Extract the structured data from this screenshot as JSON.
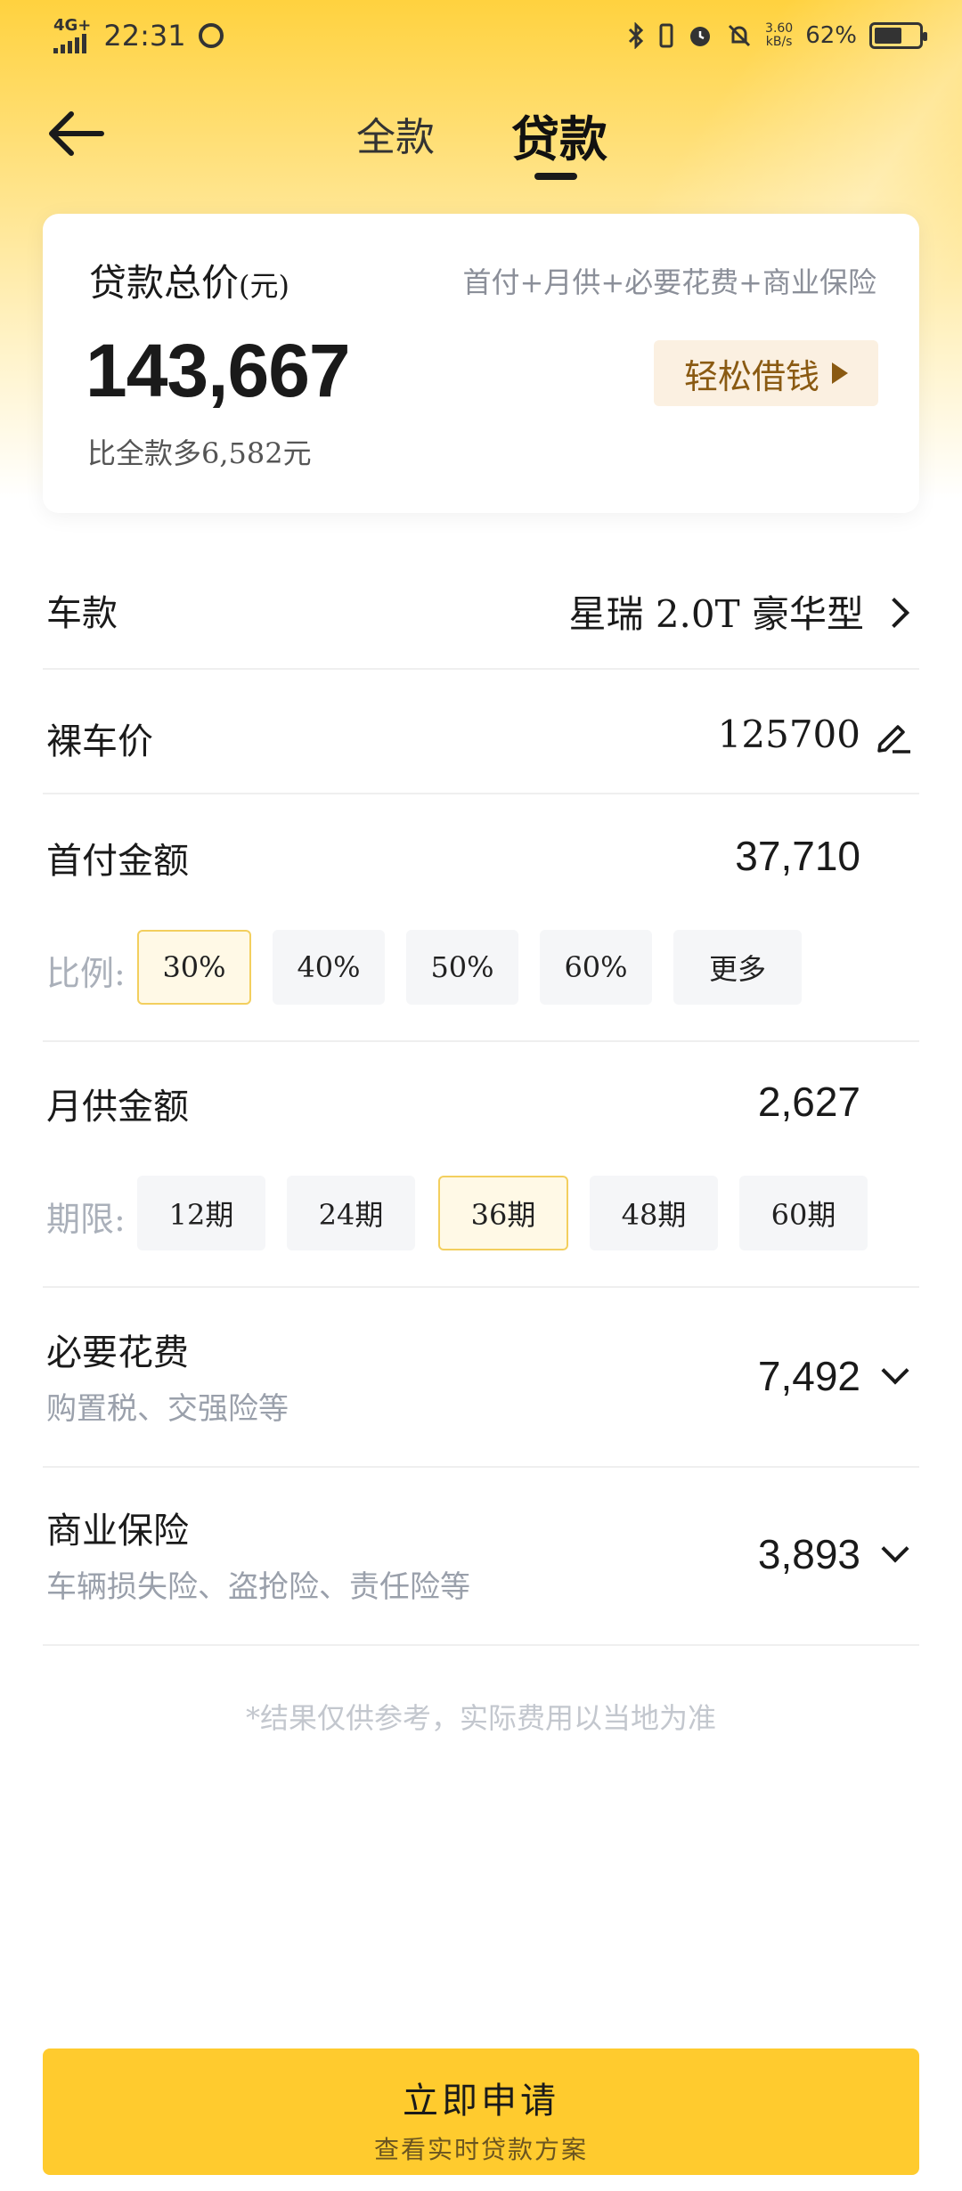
{
  "status": {
    "network": "4G+",
    "time": "22:31",
    "speed_value": "3.60",
    "speed_unit": "kB/s",
    "battery": "62%",
    "battery_level": 0.62
  },
  "nav": {
    "tab_full": "全款",
    "tab_loan": "贷款"
  },
  "summary": {
    "title": "贷款总价",
    "title_unit": "(元)",
    "formula": "首付+月供+必要花费+商业保险",
    "total": "143,667",
    "diff": "比全款多6,582元",
    "borrow_label": "轻松借钱"
  },
  "model": {
    "label": "车款",
    "value": "星瑞 2.0T 豪华型"
  },
  "price": {
    "label": "裸车价",
    "value": "125700"
  },
  "down_payment": {
    "label": "首付金额",
    "value": "37,710",
    "ratio_label": "比例:",
    "options": [
      "30%",
      "40%",
      "50%",
      "60%",
      "更多"
    ],
    "selected": "30%"
  },
  "monthly": {
    "label": "月供金额",
    "value": "2,627",
    "term_label": "期限:",
    "options": [
      "12期",
      "24期",
      "36期",
      "48期",
      "60期"
    ],
    "selected": "36期"
  },
  "necessary": {
    "label": "必要花费",
    "sub": "购置税、交强险等",
    "value": "7,492"
  },
  "insurance": {
    "label": "商业保险",
    "sub": "车辆损失险、盗抢险、责任险等",
    "value": "3,893"
  },
  "disclaimer": "*结果仅供参考，实际费用以当地为准",
  "apply": {
    "main": "立即申请",
    "sub": "查看实时贷款方案"
  }
}
